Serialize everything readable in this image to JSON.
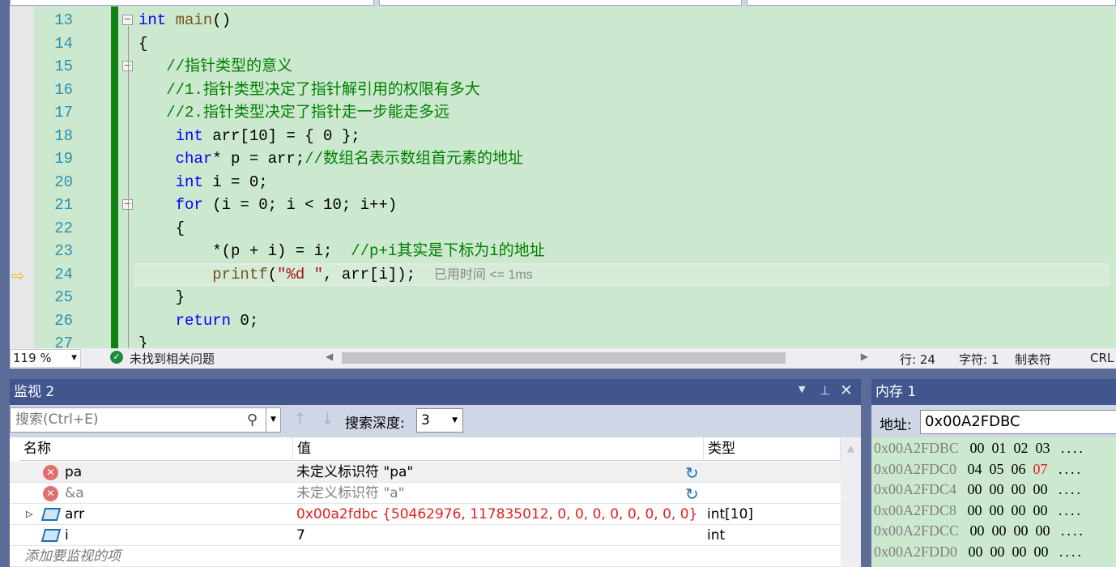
{
  "editor": {
    "lines": [
      {
        "n": "13",
        "tokens": [
          {
            "t": "int",
            "c": "kw"
          },
          {
            "t": " "
          },
          {
            "t": "main",
            "c": "fn"
          },
          {
            "t": "()"
          }
        ]
      },
      {
        "n": "14",
        "tokens": [
          {
            "t": "{"
          }
        ]
      },
      {
        "n": "15",
        "tokens": [
          {
            "t": "   "
          },
          {
            "t": "//指针类型的意义",
            "c": "cm"
          }
        ]
      },
      {
        "n": "16",
        "tokens": [
          {
            "t": "   "
          },
          {
            "t": "//1.指针类型决定了指针解引用的权限有多大",
            "c": "cm"
          }
        ]
      },
      {
        "n": "17",
        "tokens": [
          {
            "t": "   "
          },
          {
            "t": "//2.指针类型决定了指针走一步能走多远",
            "c": "cm"
          }
        ]
      },
      {
        "n": "18",
        "tokens": [
          {
            "t": "    "
          },
          {
            "t": "int",
            "c": "kw"
          },
          {
            "t": " arr[10] = { 0 };"
          }
        ]
      },
      {
        "n": "19",
        "tokens": [
          {
            "t": "    "
          },
          {
            "t": "char",
            "c": "kw"
          },
          {
            "t": "* p = arr;"
          },
          {
            "t": "//数组名表示数组首元素的地址",
            "c": "cm"
          }
        ]
      },
      {
        "n": "20",
        "tokens": [
          {
            "t": "    "
          },
          {
            "t": "int",
            "c": "kw"
          },
          {
            "t": " i = 0;"
          }
        ]
      },
      {
        "n": "21",
        "tokens": [
          {
            "t": "    "
          },
          {
            "t": "for",
            "c": "kw"
          },
          {
            "t": " (i = 0; i < 10; i++)"
          }
        ]
      },
      {
        "n": "22",
        "tokens": [
          {
            "t": "    {"
          }
        ]
      },
      {
        "n": "23",
        "tokens": [
          {
            "t": "        *(p + i) = i;  "
          },
          {
            "t": "//p+i其实是下标为i的地址",
            "c": "cm"
          }
        ]
      },
      {
        "n": "24",
        "tokens": [
          {
            "t": "        "
          },
          {
            "t": "printf",
            "c": "fn"
          },
          {
            "t": "("
          },
          {
            "t": "\"%d \"",
            "c": "st"
          },
          {
            "t": ", arr[i]);  "
          },
          {
            "t": "已用时间 <= 1ms",
            "c": "hint"
          }
        ]
      },
      {
        "n": "25",
        "tokens": [
          {
            "t": "    }"
          }
        ]
      },
      {
        "n": "26",
        "tokens": [
          {
            "t": "    "
          },
          {
            "t": "return",
            "c": "kw"
          },
          {
            "t": " 0;"
          }
        ]
      },
      {
        "n": "27",
        "tokens": [
          {
            "t": "}"
          }
        ]
      }
    ],
    "current_line": "24"
  },
  "status": {
    "zoom": "119 %",
    "issues": "未找到相关问题",
    "line": "行: 24",
    "char": "字符: 1",
    "tabs": "制表符",
    "eol": "CRL"
  },
  "watch": {
    "title": "监视 2",
    "search_placeholder": "搜索(Ctrl+E)",
    "depth_label": "搜索深度:",
    "depth_value": "3",
    "columns": [
      "名称",
      "值",
      "类型"
    ],
    "rows": [
      {
        "name": "pa",
        "value": "未定义标识符 \"pa\"",
        "type": "",
        "icon": "error-icon",
        "refresh": true,
        "dim": false
      },
      {
        "name": "&a",
        "value": "未定义标识符 \"a\"",
        "type": "",
        "icon": "error-icon",
        "refresh": true,
        "dim": true
      },
      {
        "name": "arr",
        "value": "0x00a2fdbc {50462976, 117835012, 0, 0, 0, 0, 0, 0, 0, 0}",
        "type": "int[10]",
        "icon": "variable-icon",
        "expand": true,
        "changed": true
      },
      {
        "name": "i",
        "value": "7",
        "type": "int",
        "icon": "variable-icon"
      }
    ],
    "add_item": "添加要监视的项"
  },
  "memory": {
    "title": "内存 1",
    "address_label": "地址:",
    "address": "0x00A2FDBC",
    "rows": [
      {
        "addr": "0x00A2FDBC",
        "bytes": [
          "00",
          "01",
          "02",
          "03"
        ],
        "chars": "...."
      },
      {
        "addr": "0x00A2FDC0",
        "bytes": [
          "04",
          "05",
          "06",
          "07"
        ],
        "chars": "....",
        "changed_index": 3
      },
      {
        "addr": "0x00A2FDC4",
        "bytes": [
          "00",
          "00",
          "00",
          "00"
        ],
        "chars": "...."
      },
      {
        "addr": "0x00A2FDC8",
        "bytes": [
          "00",
          "00",
          "00",
          "00"
        ],
        "chars": "...."
      },
      {
        "addr": "0x00A2FDCC",
        "bytes": [
          "00",
          "00",
          "00",
          "00"
        ],
        "chars": "...."
      },
      {
        "addr": "0x00A2FDD0",
        "bytes": [
          "00",
          "00",
          "00",
          "00"
        ],
        "chars": "...."
      }
    ]
  },
  "colors": {
    "editor_bg": "#cce8cf",
    "keyword": "#0000ff",
    "comment": "#008000",
    "changed_value": "#e02020",
    "panel_title": "#40568d"
  }
}
